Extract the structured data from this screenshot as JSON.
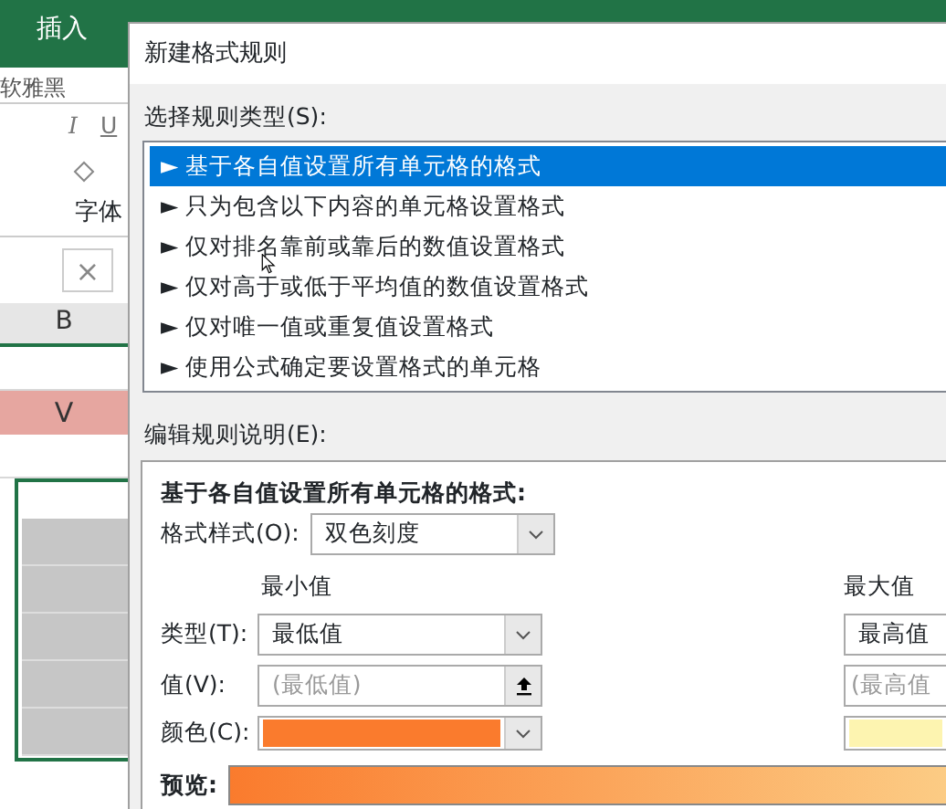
{
  "ribbon": {
    "tabs": [
      {
        "label": "插入"
      }
    ]
  },
  "excel": {
    "font_name": "软雅黑",
    "italic_key": "I",
    "underline_key": "U",
    "group_label": "字体",
    "cancel_key": "×",
    "column_header": "B",
    "cell_value": "V"
  },
  "dialog": {
    "title": "新建格式规则",
    "rule_type_label": "选择规则类型(S):",
    "rule_types": [
      {
        "label": "► 基于各自值设置所有单元格的格式",
        "selected": true
      },
      {
        "label": "► 只为包含以下内容的单元格设置格式",
        "selected": false
      },
      {
        "label": "► 仅对排名靠前或靠后的数值设置格式",
        "selected": false
      },
      {
        "label": "► 仅对高于或低于平均值的数值设置格式",
        "selected": false
      },
      {
        "label": "► 仅对唯一值或重复值设置格式",
        "selected": false
      },
      {
        "label": "► 使用公式确定要设置格式的单元格",
        "selected": false
      }
    ],
    "description_label": "编辑规则说明(E):",
    "description": {
      "heading": "基于各自值设置所有单元格的格式:",
      "style_label": "格式样式(O):",
      "style_value": "双色刻度",
      "type_label": "类型(T):",
      "value_label": "值(V):",
      "color_label": "颜色(C):",
      "preview_label": "预览:",
      "min": {
        "header": "最小值",
        "type": "最低值",
        "value_placeholder": "(最低值)",
        "color": "#fa7b2d"
      },
      "max": {
        "header": "最大值",
        "type": "最高值",
        "value_placeholder": "(最高值",
        "color": "#fdf4b0"
      }
    }
  }
}
